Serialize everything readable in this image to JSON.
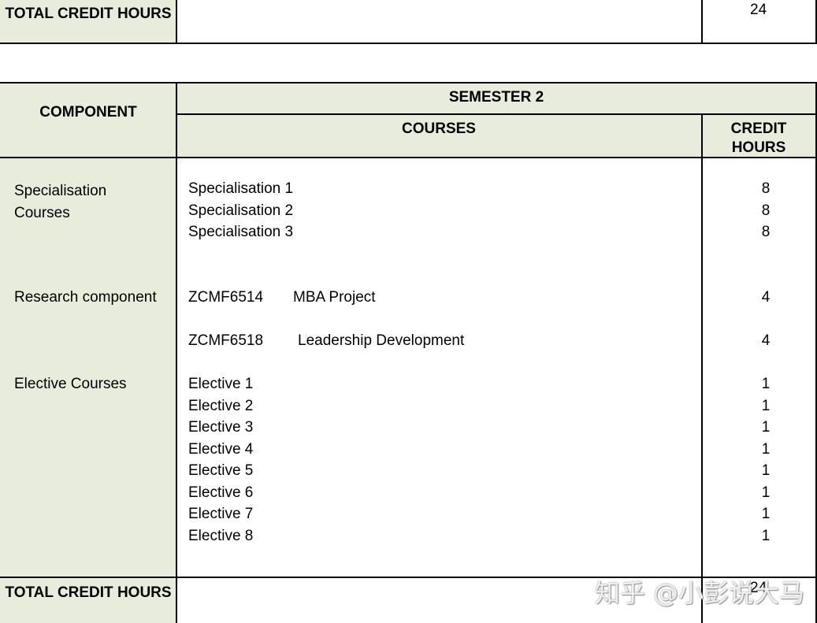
{
  "top_table": {
    "total_label": "TOTAL CREDIT HOURS",
    "total_value": "24"
  },
  "semester_table": {
    "component_header": "COMPONENT",
    "semester_header": "SEMESTER 2",
    "courses_header": "COURSES",
    "credit_header": "CREDIT HOURS",
    "components": [
      "Specialisation Courses",
      "Research component",
      "Elective Courses"
    ],
    "rows": [
      {
        "course": "Specialisation 1",
        "credit": "8"
      },
      {
        "course": "Specialisation 2",
        "credit": "8"
      },
      {
        "course": "Specialisation 3",
        "credit": "8"
      },
      {
        "code": "ZCMF6514",
        "course": "MBA Project",
        "credit": "4"
      },
      {
        "code": "ZCMF6518",
        "course": "Leadership Development",
        "credit": "4"
      },
      {
        "course": "Elective 1",
        "credit": "1"
      },
      {
        "course": "Elective 2",
        "credit": "1"
      },
      {
        "course": "Elective 3",
        "credit": "1"
      },
      {
        "course": "Elective 4",
        "credit": "1"
      },
      {
        "course": "Elective 5",
        "credit": "1"
      },
      {
        "course": "Elective 6",
        "credit": "1"
      },
      {
        "course": "Elective 7",
        "credit": "1"
      },
      {
        "course": "Elective 8",
        "credit": "1"
      }
    ],
    "total_label": "TOTAL CREDIT HOURS",
    "total_value": "24"
  },
  "watermark": "知乎 @小彭说大马",
  "colors": {
    "header_shade": "#e8ecdc"
  }
}
